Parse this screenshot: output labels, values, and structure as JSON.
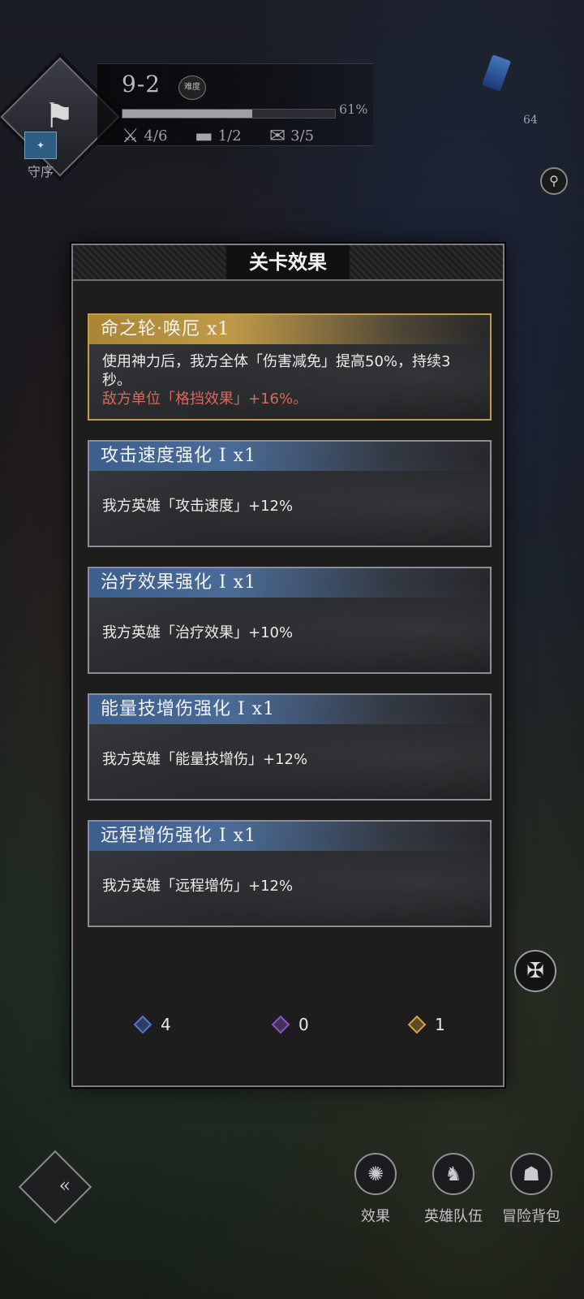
{
  "hud": {
    "stage": "9-2",
    "mode_chip": "难度",
    "progress_percent": 61,
    "progress_label": "61%",
    "stats": [
      {
        "icon": "crossed-swords-icon",
        "value": "4/6"
      },
      {
        "icon": "chest-icon",
        "value": "1/2"
      },
      {
        "icon": "scroll-icon",
        "value": "3/5"
      }
    ],
    "order_badge_label": "守序",
    "top_right_counter": "64"
  },
  "dialog": {
    "title": "关卡效果",
    "cards": [
      {
        "style": "gold",
        "title": "命之轮·唤厄 x1",
        "desc": "使用神力后，我方全体「伤害减免」提高50%，持续3秒。",
        "desc_red": "敌方单位「格挡效果」+16%。"
      },
      {
        "style": "blue",
        "title": "攻击速度强化 I x1",
        "desc": "我方英雄「攻击速度」+12%"
      },
      {
        "style": "blue",
        "title": "治疗效果强化 I x1",
        "desc": "我方英雄「治疗效果」+10%"
      },
      {
        "style": "blue",
        "title": "能量技增伤强化 I x1",
        "desc": "我方英雄「能量技增伤」+12%"
      },
      {
        "style": "blue",
        "title": "远程增伤强化 I x1",
        "desc": "我方英雄「远程增伤」+12%"
      }
    ],
    "gems": [
      {
        "color": "#4f78d6",
        "count": "4"
      },
      {
        "color": "#8a55c9",
        "count": "0"
      },
      {
        "color": "#d4a23c",
        "count": "1"
      }
    ]
  },
  "bottom_nav": [
    {
      "icon": "sun-emblem-icon",
      "label": "效果"
    },
    {
      "icon": "hero-team-icon",
      "label": "英雄队伍"
    },
    {
      "icon": "backpack-icon",
      "label": "冒险背包"
    }
  ]
}
